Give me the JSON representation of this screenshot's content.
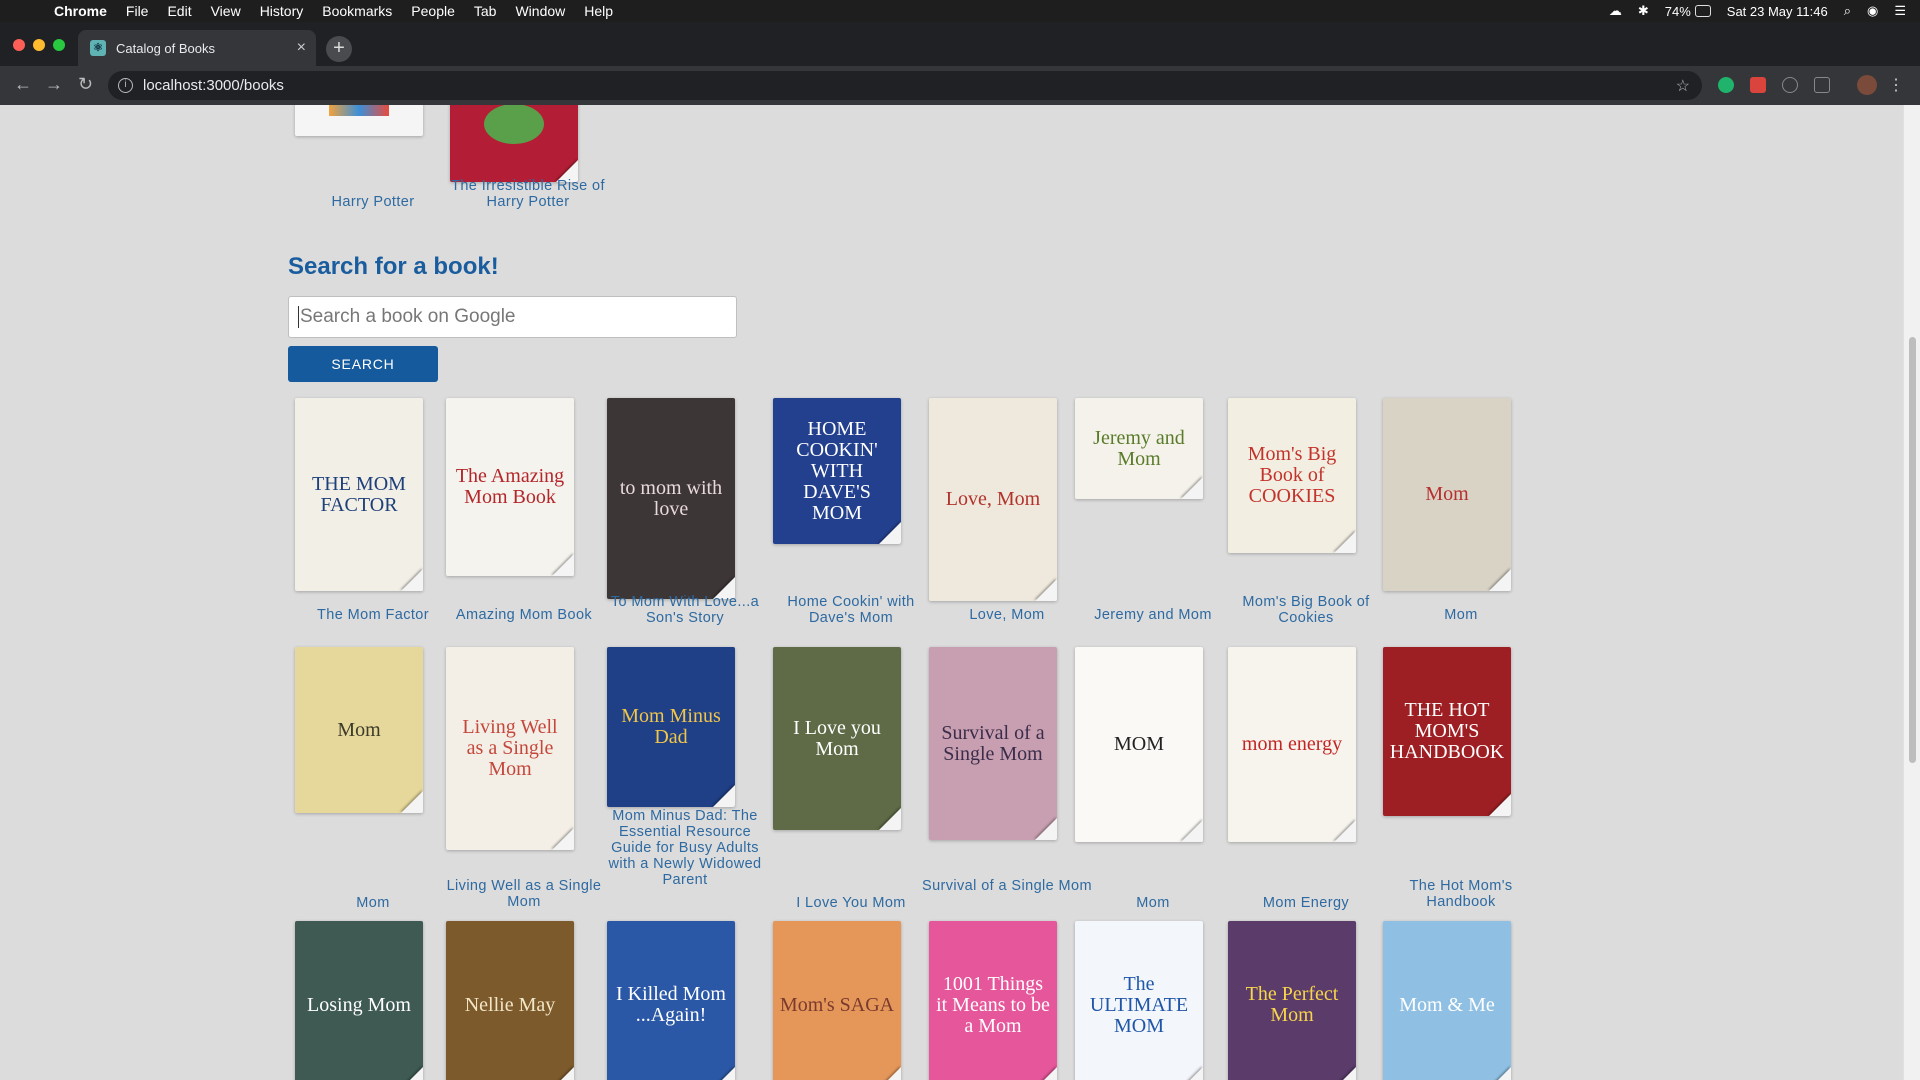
{
  "menubar": {
    "app": "Chrome",
    "items": [
      "File",
      "Edit",
      "View",
      "History",
      "Bookmarks",
      "People",
      "Tab",
      "Window",
      "Help"
    ],
    "battery": "74%",
    "datetime": "Sat 23 May  11:46"
  },
  "browser": {
    "tab_title": "Catalog of Books",
    "tab_close": "×",
    "new_tab": "+",
    "url": "localhost:3000/books",
    "back": "←",
    "forward": "→",
    "reload": "↻",
    "star": "☆",
    "menu": "⋮"
  },
  "top_books": [
    {
      "title": "Harry Potter"
    },
    {
      "title": "The Irresistible Rise of Harry Potter"
    }
  ],
  "search": {
    "heading": "Search for a book!",
    "placeholder": "Search a book on Google",
    "button": "SEARCH"
  },
  "rows": [
    [
      {
        "title": "The Mom Factor",
        "cover_text": "THE MOM FACTOR",
        "bg": "#f1efe6",
        "fg": "#1d3f7a"
      },
      {
        "title": "Amazing Mom Book",
        "cover_text": "The Amazing Mom Book",
        "bg": "#f5f3ee",
        "fg": "#b3262a"
      },
      {
        "title": "To Mom With Love...a Son's Story",
        "cover_text": "to mom with love",
        "bg": "#3d3637",
        "fg": "#e9d8dc"
      },
      {
        "title": "Home Cookin' with Dave's Mom",
        "cover_text": "HOME COOKIN' WITH DAVE'S MOM",
        "bg": "#23408e",
        "fg": "#ffffff"
      },
      {
        "title": "Love, Mom",
        "cover_text": "Love, Mom",
        "bg": "#efe8dc",
        "fg": "#b1332c"
      },
      {
        "title": "Jeremy and Mom",
        "cover_text": "Jeremy and Mom",
        "bg": "#f4f2ea",
        "fg": "#5a7b2a"
      },
      {
        "title": "Mom's Big Book of Cookies",
        "cover_text": "Mom's Big Book of COOKIES",
        "bg": "#f3eee2",
        "fg": "#c2332b"
      },
      {
        "title": "Mom",
        "cover_text": "Mom",
        "bg": "#d9d3c6",
        "fg": "#b5302f"
      }
    ],
    [
      {
        "title": "Mom",
        "cover_text": "Mom",
        "bg": "#e6d79a",
        "fg": "#3c3a2a"
      },
      {
        "title": "Living Well as a Single Mom",
        "cover_text": "Living Well as a Single Mom",
        "bg": "#f4efe6",
        "fg": "#c4473c"
      },
      {
        "title": "Mom Minus Dad: The Essential Resource Guide for Busy Adults with a Newly Widowed Parent",
        "cover_text": "Mom Minus Dad",
        "bg": "#1f3f86",
        "fg": "#f0c54a"
      },
      {
        "title": "I Love You Mom",
        "cover_text": "I Love you Mom",
        "bg": "#5e6b46",
        "fg": "#ffffff"
      },
      {
        "title": "Survival of a Single Mom",
        "cover_text": "Survival of a Single Mom",
        "bg": "#c89fb1",
        "fg": "#3b2d4a"
      },
      {
        "title": "Mom",
        "cover_text": "MOM",
        "bg": "#faf9f6",
        "fg": "#222222"
      },
      {
        "title": "Mom Energy",
        "cover_text": "mom energy",
        "bg": "#f7f4ee",
        "fg": "#c22623"
      },
      {
        "title": "The Hot Mom's Handbook",
        "cover_text": "THE HOT MOM'S HANDBOOK",
        "bg": "#9e1f23",
        "fg": "#ffffff"
      }
    ],
    [
      {
        "title": "",
        "cover_text": "Losing Mom",
        "bg": "#3e5a52",
        "fg": "#ffffff"
      },
      {
        "title": "",
        "cover_text": "Nellie May",
        "bg": "#7d5a2b",
        "fg": "#f1e6c8"
      },
      {
        "title": "",
        "cover_text": "I Killed Mom ...Again!",
        "bg": "#2b58a6",
        "fg": "#ffffff"
      },
      {
        "title": "",
        "cover_text": "Mom's SAGA",
        "bg": "#e5975a",
        "fg": "#7a3a2e"
      },
      {
        "title": "",
        "cover_text": "1001 Things it Means to be a Mom",
        "bg": "#e6569a",
        "fg": "#ffffff"
      },
      {
        "title": "",
        "cover_text": "The ULTIMATE MOM",
        "bg": "#f3f6fb",
        "fg": "#1f56a8"
      },
      {
        "title": "",
        "cover_text": "The Perfect Mom",
        "bg": "#5a3b6a",
        "fg": "#f7d54a"
      },
      {
        "title": "",
        "cover_text": "Mom & Me",
        "bg": "#8fc0e3",
        "fg": "#ffffff"
      }
    ]
  ]
}
